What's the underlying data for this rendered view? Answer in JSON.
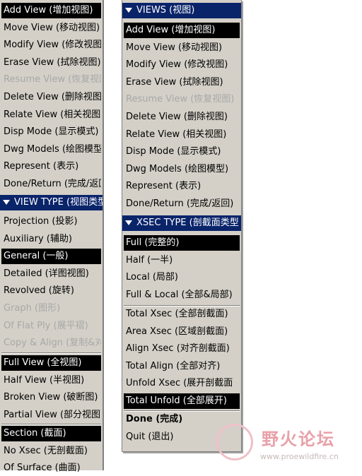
{
  "left_menu": {
    "items": [
      {
        "label": "Add View (增加视图)",
        "state": "selected"
      },
      {
        "label": "Move View (移动视图)",
        "state": "normal"
      },
      {
        "label": "Modify View (修改视图",
        "state": "normal"
      },
      {
        "label": "Erase View (拭除视图)",
        "state": "normal"
      },
      {
        "label": "Resume View (恢复视图",
        "state": "disabled"
      },
      {
        "label": "Delete View (删除视图)",
        "state": "normal"
      },
      {
        "label": "Relate View (相关视图)",
        "state": "normal"
      },
      {
        "label": "Disp Mode (显示模式)",
        "state": "normal"
      },
      {
        "label": "Dwg Models (绘图模型",
        "state": "normal"
      },
      {
        "label": "Represent (表示)",
        "state": "normal"
      },
      {
        "label": "Done/Return (完成/返回",
        "state": "normal"
      }
    ],
    "view_type_header": "VIEW TYPE (视图类型",
    "view_type_items": [
      {
        "label": "Projection (投影)",
        "state": "normal"
      },
      {
        "label": "Auxiliary (辅助)",
        "state": "normal"
      },
      {
        "label": "General (一般)",
        "state": "selected"
      },
      {
        "label": "Detailed (详图视图)",
        "state": "normal"
      },
      {
        "label": "Revolved (旋转)",
        "state": "normal"
      },
      {
        "label": "Graph (图形)",
        "state": "disabled"
      },
      {
        "label": "Of Flat Ply (展平褶)",
        "state": "disabled"
      },
      {
        "label": "Copy & Align (复制&对",
        "state": "disabled"
      }
    ],
    "view_scope_items": [
      {
        "label": "Full View (全视图)",
        "state": "selected"
      },
      {
        "label": "Half View (半视图)",
        "state": "normal"
      },
      {
        "label": "Broken View (破断图)",
        "state": "normal"
      },
      {
        "label": "Partial View (部分视图",
        "state": "normal"
      }
    ],
    "section_items": [
      {
        "label": "Section (截面)",
        "state": "selected"
      },
      {
        "label": "No Xsec (无剖截面)",
        "state": "normal"
      },
      {
        "label": "Of Surface (曲面)",
        "state": "normal"
      }
    ]
  },
  "right_menu": {
    "views_header": "VIEWS (视图)",
    "views_items": [
      {
        "label": "Add View (增加视图)",
        "state": "selected"
      },
      {
        "label": "Move View (移动视图)",
        "state": "normal"
      },
      {
        "label": "Modify View (修改视图)",
        "state": "normal"
      },
      {
        "label": "Erase View (拭除视图)",
        "state": "normal"
      },
      {
        "label": "Resume View (恢复视图)",
        "state": "disabled"
      },
      {
        "label": "Delete View (删除视图)",
        "state": "normal"
      },
      {
        "label": "Relate View (相关视图)",
        "state": "normal"
      },
      {
        "label": "Disp Mode (显示模式)",
        "state": "normal"
      },
      {
        "label": "Dwg Models (绘图模型)",
        "state": "normal"
      },
      {
        "label": "Represent (表示)",
        "state": "normal"
      },
      {
        "label": "Done/Return (完成/返回)",
        "state": "normal"
      }
    ],
    "xsec_header": "XSEC TYPE (剖截面类型",
    "xsec_items": [
      {
        "label": "Full (完整的)",
        "state": "selected"
      },
      {
        "label": "Half (一半)",
        "state": "normal"
      },
      {
        "label": "Local (局部)",
        "state": "normal"
      },
      {
        "label": "Full & Local (全部&局部)",
        "state": "normal"
      }
    ],
    "xsec_items2": [
      {
        "label": "Total Xsec (全部剖截面)",
        "state": "normal"
      },
      {
        "label": "Area Xsec (区域剖截面)",
        "state": "normal"
      },
      {
        "label": "Align Xsec (对齐剖截面)",
        "state": "normal"
      },
      {
        "label": "Total Align (全部对齐)",
        "state": "normal"
      },
      {
        "label": "Unfold Xsec (展开剖截面",
        "state": "normal"
      },
      {
        "label": "Total Unfold (全部展开)",
        "state": "selected"
      }
    ],
    "done_label": "Done (完成)",
    "quit_label": "Quit (退出)"
  },
  "watermark": {
    "title": "野火论坛",
    "url": "www.proewildfire.cn"
  }
}
